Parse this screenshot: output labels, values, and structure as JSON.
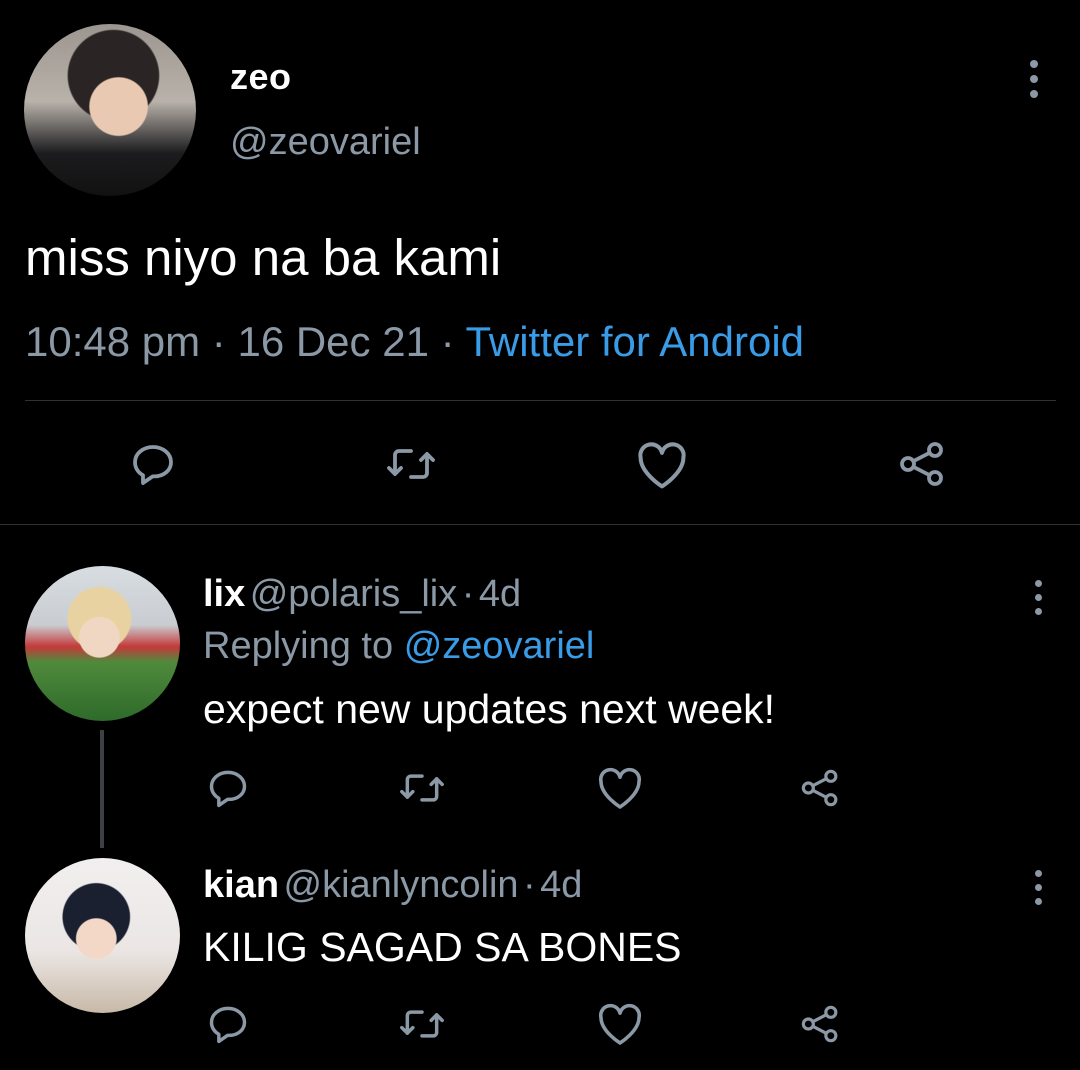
{
  "tweet": {
    "author_name": "zeo",
    "author_handle": "@zeovariel",
    "text": "miss niyo na ba kami",
    "time": "10:48 pm",
    "date": "16 Dec 21",
    "separator": "·",
    "source": "Twitter for Android"
  },
  "actions": {
    "reply_icon": "reply-icon",
    "retweet_icon": "retweet-icon",
    "like_icon": "heart-icon",
    "share_icon": "share-icon",
    "more_icon": "more-vertical-icon"
  },
  "replies": [
    {
      "name": "lix",
      "handle": "@polaris_lix",
      "age": "4d",
      "replying_label": "Replying to",
      "replying_to": "@zeovariel",
      "text": "expect new updates next week!"
    },
    {
      "name": "kian",
      "handle": "@kianlyncolin",
      "age": "4d",
      "text": "KILIG SAGAD SA BONES"
    }
  ],
  "colors": {
    "background": "#000000",
    "text": "#ffffff",
    "secondary": "#8b98a5",
    "link": "#3a9be6",
    "divider": "#2f3336"
  }
}
